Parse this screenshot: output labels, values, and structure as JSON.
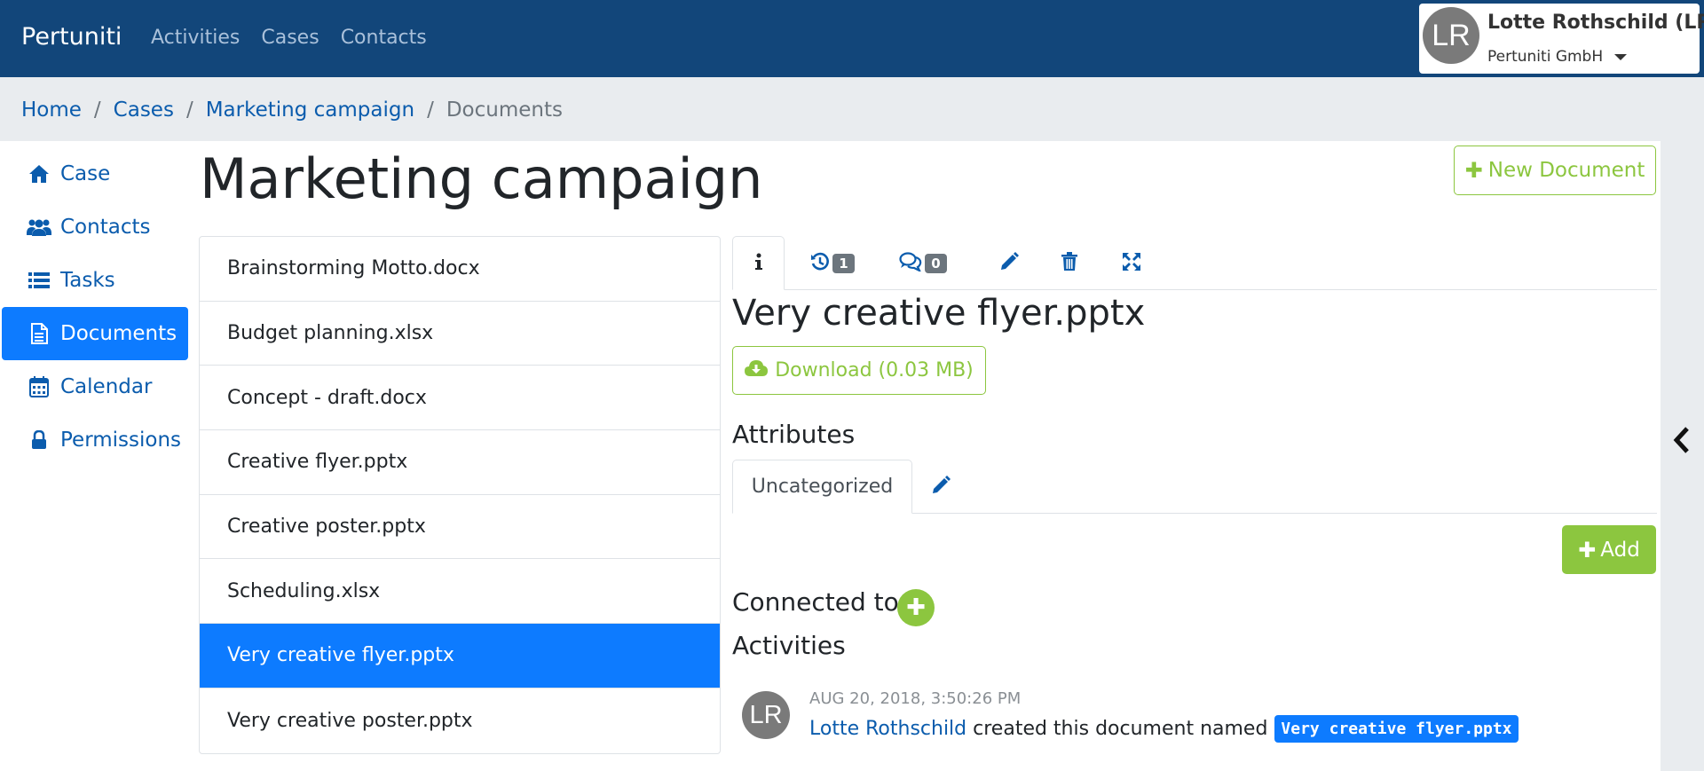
{
  "navbar": {
    "brand": "Pertuniti",
    "links": [
      "Activities",
      "Cases",
      "Contacts"
    ],
    "user": {
      "initials": "LR",
      "name": "Lotte Rothschild (LR)",
      "org": "Pertuniti GmbH"
    }
  },
  "breadcrumb": {
    "items": [
      "Home",
      "Cases",
      "Marketing campaign"
    ],
    "current": "Documents",
    "separator": "/"
  },
  "sidebar": {
    "items": [
      {
        "label": "Case",
        "icon": "home-icon"
      },
      {
        "label": "Contacts",
        "icon": "users-icon"
      },
      {
        "label": "Tasks",
        "icon": "list-icon"
      },
      {
        "label": "Documents",
        "icon": "file-icon",
        "active": true
      },
      {
        "label": "Calendar",
        "icon": "calendar-icon"
      },
      {
        "label": "Permissions",
        "icon": "lock-icon"
      }
    ]
  },
  "page": {
    "title": "Marketing campaign",
    "new_document_label": "New Document"
  },
  "documents": {
    "items": [
      "Brainstorming Motto.docx",
      "Budget planning.xlsx",
      "Concept - draft.docx",
      "Creative flyer.pptx",
      "Creative poster.pptx",
      "Scheduling.xlsx",
      "Very creative flyer.pptx",
      "Very creative poster.pptx"
    ],
    "selected_index": 6
  },
  "detail": {
    "tabs": {
      "history_count": "1",
      "comments_count": "0"
    },
    "title": "Very creative flyer.pptx",
    "download_label": "Download (0.03 MB)",
    "attributes_heading": "Attributes",
    "attribute_tab": "Uncategorized",
    "add_label": "Add",
    "connected_heading": "Connected to",
    "activities_heading": "Activities",
    "activity": {
      "initials": "LR",
      "timestamp": "AUG 20, 2018, 3:50:26 PM",
      "user": "Lotte Rothschild",
      "text": "created this document named",
      "document": "Very creative flyer.pptx"
    }
  },
  "colors": {
    "navbar": "#12467a",
    "primary": "#0d7bff",
    "accent_green": "#8cc63f",
    "link": "#0b5cad"
  }
}
